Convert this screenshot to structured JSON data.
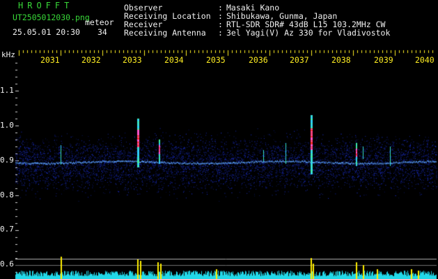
{
  "header": {
    "brand": "HROFFT",
    "filename": "UT2505012030.png",
    "meteor_label": "meteor",
    "datetime": "25.05.01 20:30",
    "count": "34",
    "fields": [
      {
        "label": "Observer",
        "value": "Masaki Kano"
      },
      {
        "label": "Receiving Location",
        "value": "Shibukawa, Gunma, Japan"
      },
      {
        "label": "Receiver",
        "value": "RTL-SDR SDR# 43dB L15 103.2MHz CW"
      },
      {
        "label": "Receiving Antenna",
        "value": "3el Yagi(V) Az 330 for Vladivostok"
      }
    ]
  },
  "spectrogram": {
    "y_unit": "kHz",
    "y_ticks": [
      "1.1",
      "1.0",
      "0.9",
      "0.8",
      "0.7",
      "0.6"
    ],
    "x_ticks": [
      "2031",
      "2032",
      "2033",
      "2034",
      "2035",
      "2036",
      "2037",
      "2038",
      "2039",
      "2040"
    ],
    "colors": {
      "background": "#000000",
      "noise": "#1a2fd0",
      "carrier": "#5aa0ff",
      "echo_hot": "#ff3030",
      "tick_text": "#ffee22",
      "level_bars": "#22d8e8",
      "level_spikes": "#ffee00"
    }
  }
}
